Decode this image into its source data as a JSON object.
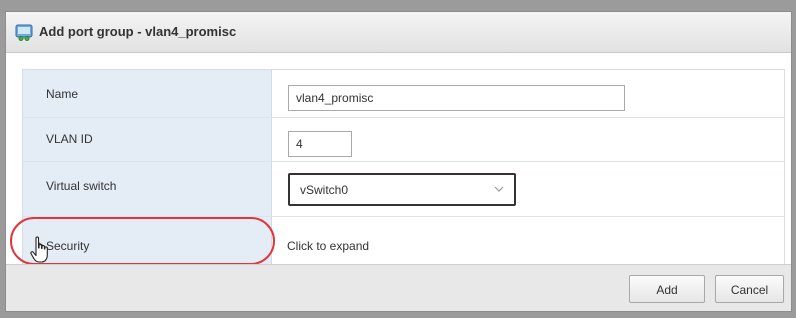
{
  "dialog": {
    "title": "Add port group - vlan4_promisc",
    "title_icon": "port-group-icon"
  },
  "form": {
    "name": {
      "label": "Name",
      "value": "vlan4_promisc"
    },
    "vlan_id": {
      "label": "VLAN ID",
      "value": "4"
    },
    "virtual_switch": {
      "label": "Virtual switch",
      "selected": "vSwitch0"
    },
    "security": {
      "label": "Security",
      "value": "Click to expand",
      "expanded": false
    }
  },
  "buttons": {
    "add_label": "Add",
    "cancel_label": "Cancel"
  },
  "annotation": {
    "highlight_color": "#e0353b"
  },
  "colors": {
    "label_column_bg": "#e4ecf5",
    "footer_bg": "#e8e8e8"
  }
}
